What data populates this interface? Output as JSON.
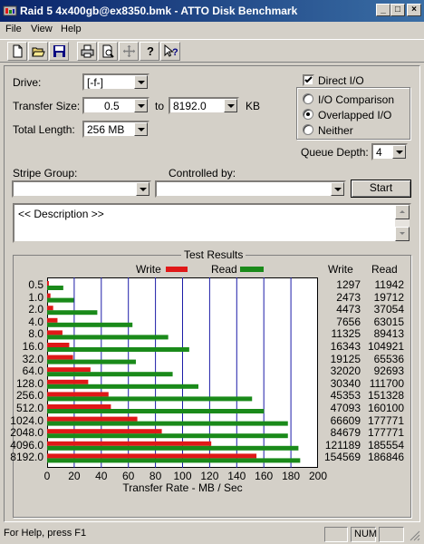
{
  "window": {
    "title": "Raid 5 4x400gb@ex8350.bmk - ATTO Disk Benchmark",
    "buttons": {
      "minimize": "_",
      "maximize": "□",
      "close": "×"
    }
  },
  "menu": [
    "File",
    "View",
    "Help"
  ],
  "toolbar": {
    "icons": [
      "new-file-icon",
      "open-folder-icon",
      "save-icon",
      "print-icon",
      "print-preview-icon",
      "move-icon",
      "help-icon",
      "context-help-icon"
    ]
  },
  "form": {
    "drive_label": "Drive:",
    "drive_value": "[-f-]",
    "transfer_label": "Transfer Size:",
    "transfer_from": "0.5",
    "to_label": "to",
    "transfer_to": "8192.0",
    "kb_label": "KB",
    "total_label": "Total Length:",
    "total_value": "256 MB",
    "direct_io_label": "Direct I/O",
    "direct_io_checked": true,
    "io_comparison_label": "I/O Comparison",
    "overlapped_label": "Overlapped I/O",
    "neither_label": "Neither",
    "queue_label": "Queue Depth:",
    "queue_value": "4",
    "stripe_label": "Stripe Group:",
    "controlled_label": "Controlled by:",
    "start_label": "Start",
    "description": "<< Description >>"
  },
  "results": {
    "title": "Test Results",
    "legend_write": "Write",
    "legend_read": "Read",
    "col_write": "Write",
    "col_read": "Read"
  },
  "colors": {
    "write": "#e01818",
    "read": "#1a8a1a",
    "grid": "#1c1ca8"
  },
  "chart_data": {
    "type": "bar",
    "orientation": "horizontal",
    "xlabel": "Transfer Rate - MB / Sec",
    "xlim": [
      0,
      200
    ],
    "xticks": [
      0,
      20,
      40,
      60,
      80,
      100,
      120,
      140,
      160,
      180,
      200
    ],
    "categories": [
      "0.5",
      "1.0",
      "2.0",
      "4.0",
      "8.0",
      "16.0",
      "32.0",
      "64.0",
      "128.0",
      "256.0",
      "512.0",
      "1024.0",
      "2048.0",
      "4096.0",
      "8192.0"
    ],
    "series": [
      {
        "name": "Write",
        "values": [
          1297,
          2473,
          4473,
          7656,
          11325,
          16343,
          19125,
          32020,
          30340,
          45353,
          47093,
          66609,
          84679,
          121189,
          154569
        ]
      },
      {
        "name": "Read",
        "values": [
          11942,
          19712,
          37054,
          63015,
          89413,
          104921,
          65536,
          92693,
          111700,
          151328,
          160100,
          177771,
          177771,
          185554,
          186846
        ]
      }
    ]
  },
  "status": {
    "help": "For Help, press F1",
    "num": "NUM"
  }
}
